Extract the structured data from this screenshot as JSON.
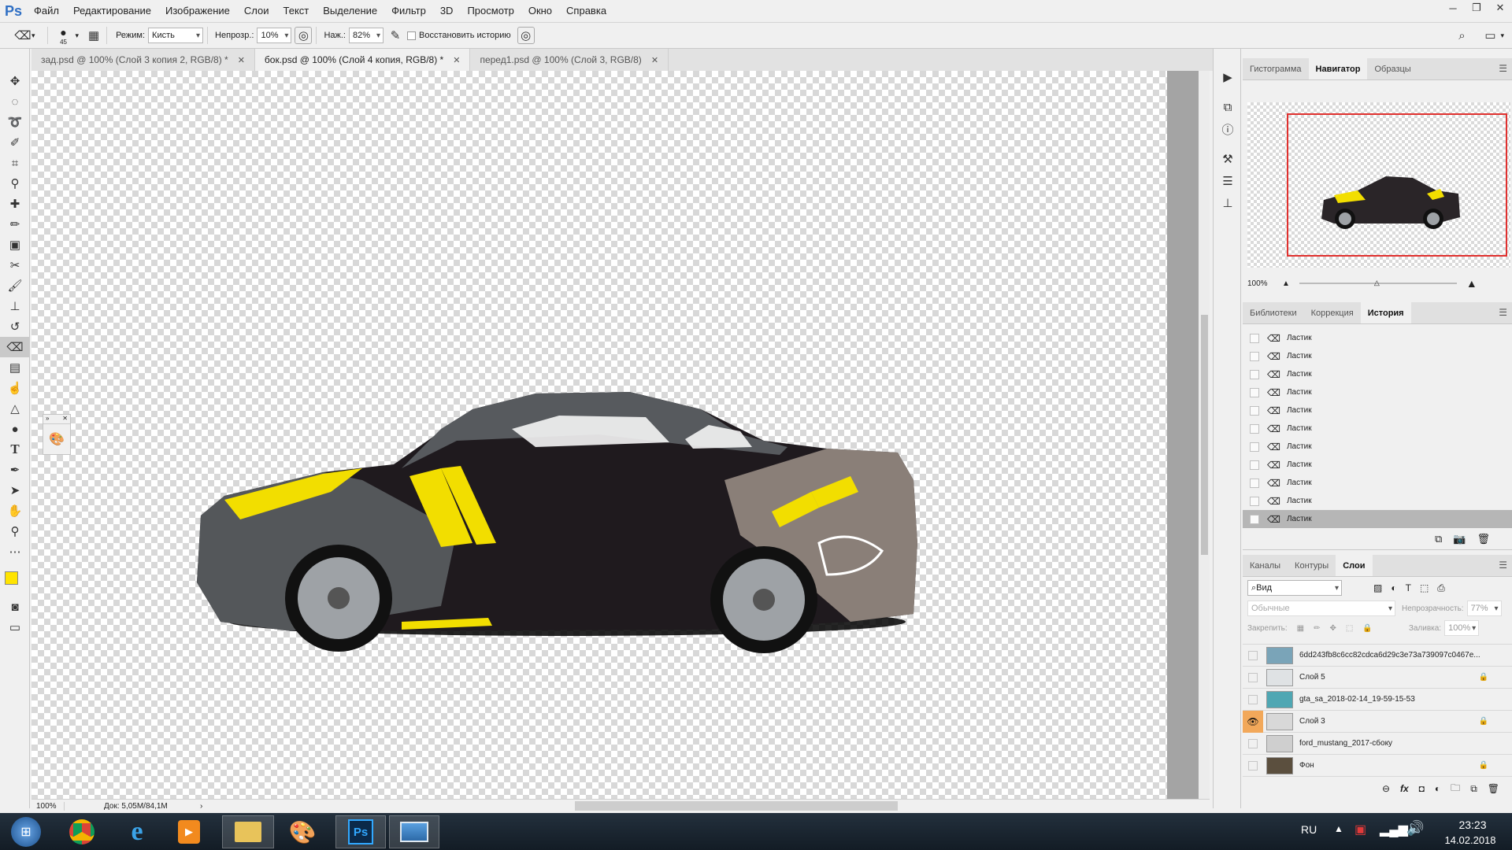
{
  "app": {
    "logo": "Ps"
  },
  "menu": [
    "Файл",
    "Редактирование",
    "Изображение",
    "Слои",
    "Текст",
    "Выделение",
    "Фильтр",
    "3D",
    "Просмотр",
    "Окно",
    "Справка"
  ],
  "options": {
    "brush_size": "45",
    "mode_label": "Режим:",
    "mode_value": "Кисть",
    "opacity_label": "Непрозр.:",
    "opacity_value": "10%",
    "pressure_label": "Наж.:",
    "pressure_value": "82%",
    "restore_history": "Восстановить историю"
  },
  "doc_tabs": [
    {
      "label": "зад.psd @ 100% (Слой 3 копия 2, RGB/8) *",
      "active": false
    },
    {
      "label": "бок.psd @ 100% (Слой 4 копия, RGB/8) *",
      "active": true
    },
    {
      "label": "перед1.psd @ 100% (Слой 3, RGB/8)",
      "active": false
    }
  ],
  "status": {
    "zoom": "100%",
    "doc": "Док: 5,05M/84,1M"
  },
  "navigator": {
    "tabs": [
      "Гистограмма",
      "Навигатор",
      "Образцы"
    ],
    "zoom": "100%"
  },
  "history": {
    "tabs": [
      "Библиотеки",
      "Коррекция",
      "История"
    ],
    "items": [
      "Ластик",
      "Ластик",
      "Ластик",
      "Ластик",
      "Ластик",
      "Ластик",
      "Ластик",
      "Ластик",
      "Ластик",
      "Ластик",
      "Ластик"
    ]
  },
  "layers": {
    "tabs": [
      "Каналы",
      "Контуры",
      "Слои"
    ],
    "filter": "Вид",
    "blend": "Обычные",
    "opacity_label": "Непрозрачность:",
    "opacity_value": "77%",
    "lock_label": "Закрепить:",
    "fill_label": "Заливка:",
    "fill_value": "100%",
    "items": [
      {
        "name": "6dd243fb8c6cc82cdca6d29c3e73a739097c0467e...",
        "visible": false,
        "locked": false,
        "thumb": "#7aa4b8"
      },
      {
        "name": "Слой 5",
        "visible": false,
        "locked": true,
        "thumb": "#dfe2e4"
      },
      {
        "name": "gta_sa_2018-02-14_19-59-15-53",
        "visible": false,
        "locked": false,
        "thumb": "#4fa7b3"
      },
      {
        "name": "Слой 3",
        "visible": true,
        "locked": true,
        "thumb": "#d8d8d8"
      },
      {
        "name": "ford_mustang_2017-сбоку",
        "visible": false,
        "locked": false,
        "thumb": "#cfcfcf"
      },
      {
        "name": "Фон",
        "visible": false,
        "locked": true,
        "thumb": "#5b4f3e"
      }
    ]
  },
  "taskbar": {
    "lang": "RU",
    "time": "23:23",
    "date": "14.02.2018"
  },
  "colors": {
    "foreground": "#ffe400",
    "background": "#ffffff",
    "car_stripe": "#f2de00"
  }
}
